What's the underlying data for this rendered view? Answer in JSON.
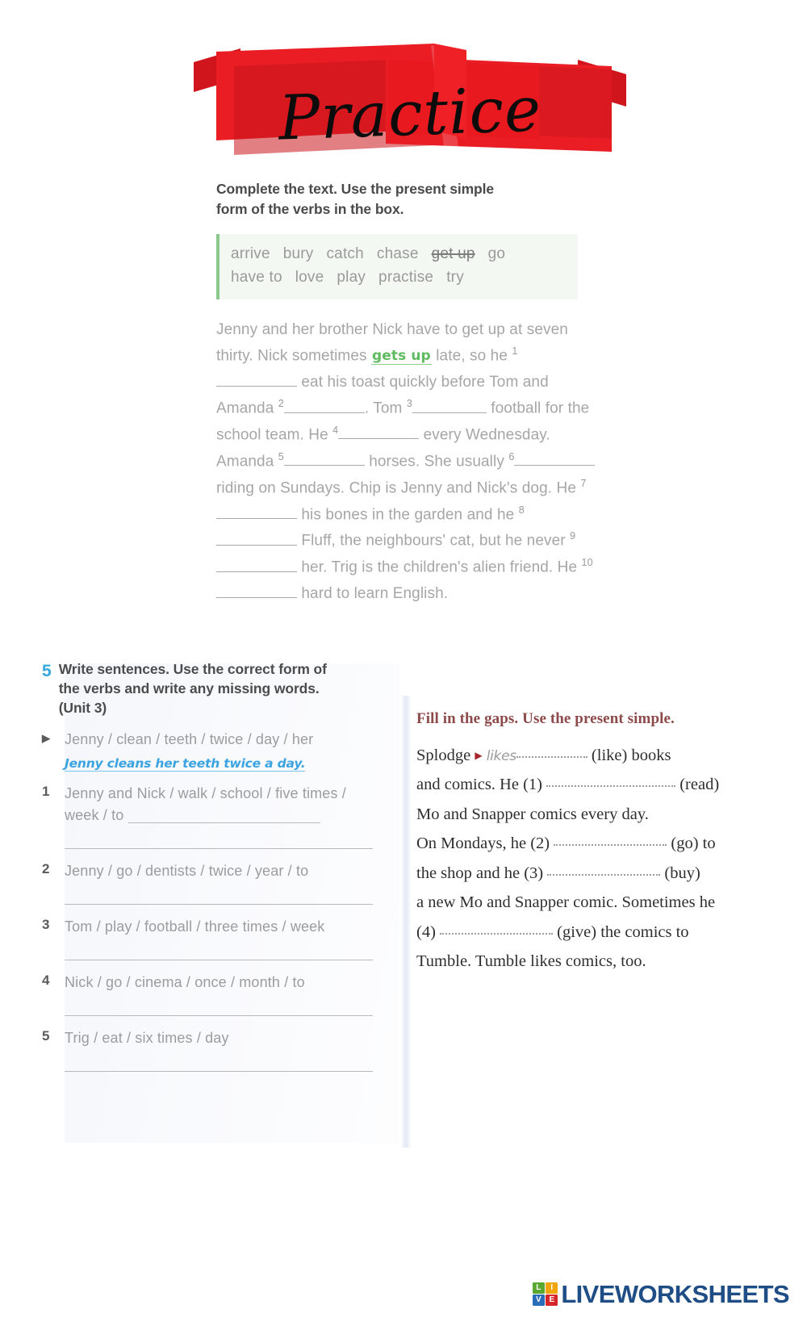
{
  "banner": {
    "title": "Practice",
    "ribbon_color": "#ea1c24"
  },
  "exercise_4": {
    "instruction_line1": "Complete the text. Use the present simple",
    "instruction_line2": "form of the verbs in the box.",
    "wordbox": {
      "row1": [
        "arrive",
        "bury",
        "catch",
        "chase",
        "get up",
        "go"
      ],
      "row2": [
        "have to",
        "love",
        "play",
        "practise",
        "try"
      ],
      "struck_word": "get up",
      "accent_color": "#8cc98c",
      "background_color": "#f3f8f3"
    },
    "passage": {
      "p1": "Jenny and her brother Nick have to get up at",
      "p2a": "seven thirty. Nick sometimes ",
      "example_answer": "gets up",
      "p2b": " late,",
      "p3a": "so he ",
      "n1": "1",
      "p3b": " eat his toast quickly before",
      "p4a": "Tom and Amanda ",
      "n2": "2",
      "p4b": ". Tom ",
      "n3": "3",
      "p5a": "football for the school team. He ",
      "n4": "4",
      "p6a": "every Wednesday. Amanda ",
      "n5": "5",
      "p6b": " horses.",
      "p7a": "She usually ",
      "n6": "6",
      "p7b": " riding on Sundays.",
      "p8a": "Chip is Jenny and Nick's dog. He ",
      "n7": "7",
      "p9a": "his bones in the garden and he ",
      "n8": "8",
      "p10a": "Fluff, the neighbours' cat, but he never",
      "n9": "9",
      "p11b": " her. Trig is the children's alien",
      "p12a": "friend. He ",
      "n10": "10",
      "p12b": " hard to learn English."
    }
  },
  "exercise_5": {
    "number": "5",
    "number_color": "#35a8dd",
    "instruction_line1": "Write sentences. Use the correct form of",
    "instruction_line2": "the verbs and write any missing words.",
    "instruction_line3": "(Unit 3)",
    "example": {
      "marker": "▶",
      "prompt": "Jenny / clean / teeth / twice / day / her",
      "answer": "Jenny cleans her teeth twice a day.",
      "answer_color": "#3ba3e0"
    },
    "items": [
      {
        "number": "1",
        "prompt_line1": "Jenny and Nick / walk / school / five times /",
        "prompt_line2": "week / to",
        "lines": 2
      },
      {
        "number": "2",
        "prompt_line1": "Jenny / go / dentists / twice / year / to",
        "prompt_line2": "",
        "lines": 1
      },
      {
        "number": "3",
        "prompt_line1": "Tom / play / football / three times / week",
        "prompt_line2": "",
        "lines": 1
      },
      {
        "number": "4",
        "prompt_line1": "Nick / go / cinema / once / month / to",
        "prompt_line2": "",
        "lines": 1
      },
      {
        "number": "5",
        "prompt_line1": "Trig / eat / six times / day",
        "prompt_line2": "",
        "lines": 1
      }
    ]
  },
  "fill_gaps": {
    "title": "Fill in the gaps. Use the present simple.",
    "title_color": "#8d4a4a",
    "example_answer": "likes",
    "text": {
      "l1a": "Splodge",
      "l1_marker": "▶",
      "l1b": "(like) books",
      "l2a": "and comics. He (1)",
      "l2b": "(read)",
      "l3": "Mo and Snapper comics every day.",
      "l4a": "On Mondays, he (2)",
      "l4b": "(go) to",
      "l5a": "the shop and he (3)",
      "l5b": "(buy)",
      "l6": "a new Mo and Snapper comic. Sometimes he",
      "l7a": "(4)",
      "l7b": "(give) the comics to",
      "l8": "Tumble. Tumble likes comics, too."
    }
  },
  "footer": {
    "logo_tiles": [
      "L",
      "I",
      "V",
      "E"
    ],
    "logo_text": "LIVEWORKSHEETS",
    "logo_text_color": "#1f4e87"
  }
}
